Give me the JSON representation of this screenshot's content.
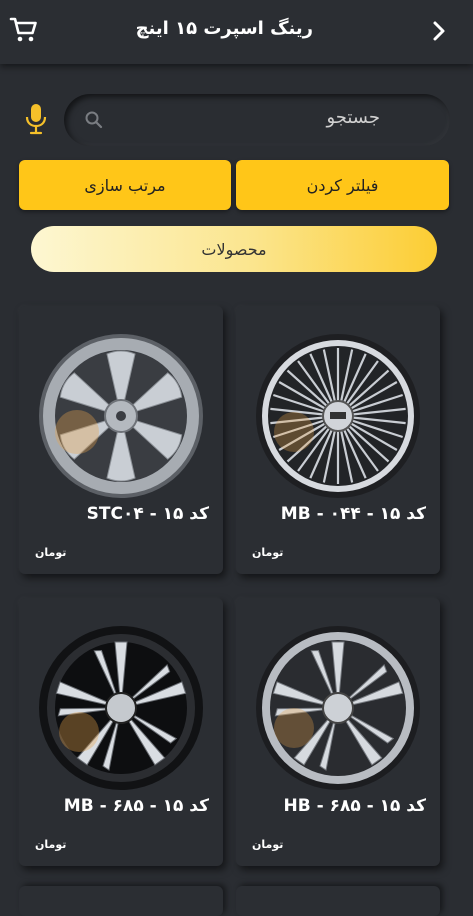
{
  "header": {
    "title": "رینگ اسپرت ۱۵ اینچ",
    "cart_icon": "cart-icon",
    "back_icon": "chevron-right-icon"
  },
  "search": {
    "placeholder": "جستجو",
    "mic_icon": "microphone-icon",
    "search_icon": "search-icon"
  },
  "actions": {
    "sort_label": "مرتب سازی",
    "filter_label": "فیلتر کردن"
  },
  "category": {
    "label": "محصولات"
  },
  "products": [
    {
      "code": "کد ۱۵ - STC۰۴",
      "price": "تومان",
      "style": "silver-six-spoke"
    },
    {
      "code": "کد ۱۵ - ۰۴۴ - MB",
      "price": "تومان",
      "style": "multi-spoke-black"
    },
    {
      "code": "کد ۱۵ - ۶۸۵ - MB",
      "price": "تومان",
      "style": "star-black-machined"
    },
    {
      "code": "کد ۱۵ - ۶۸۵ - HB",
      "price": "تومان",
      "style": "star-silver"
    }
  ],
  "colors": {
    "background": "#2a2d32",
    "accent": "#ffc618",
    "mic": "#f5c02a"
  }
}
